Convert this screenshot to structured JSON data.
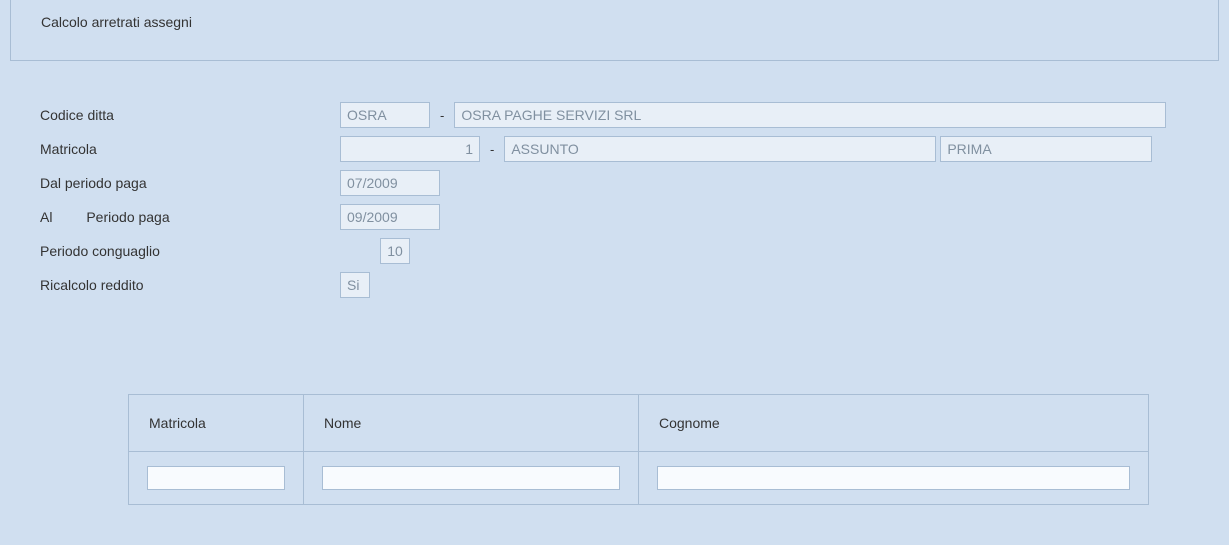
{
  "header": {
    "title": "Calcolo arretrati assegni"
  },
  "form": {
    "codice_ditta_label": "Codice ditta",
    "codice_ditta_value": "OSRA",
    "codice_ditta_desc": "OSRA PAGHE SERVIZI SRL",
    "separator": "-",
    "matricola_label": "Matricola",
    "matricola_value": "1",
    "matricola_desc1": "ASSUNTO",
    "matricola_desc2": "PRIMA",
    "dal_periodo_label": "Dal periodo paga",
    "dal_periodo_value": "07/2009",
    "al_label": "Al",
    "periodo_paga_label": "Periodo paga",
    "al_periodo_value": "09/2009",
    "periodo_conguaglio_label": "Periodo conguaglio",
    "periodo_conguaglio_value": "10",
    "ricalcolo_label": "Ricalcolo reddito",
    "ricalcolo_value": "Si"
  },
  "table": {
    "headers": {
      "matricola": "Matricola",
      "nome": "Nome",
      "cognome": "Cognome"
    },
    "filters": {
      "matricola": "",
      "nome": "",
      "cognome": ""
    }
  }
}
